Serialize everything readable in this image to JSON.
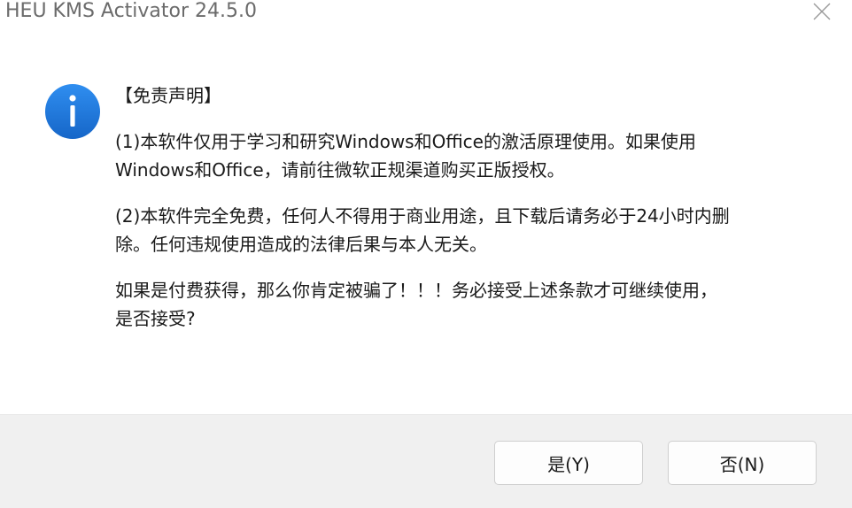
{
  "window": {
    "title": "HEU KMS Activator 24.5.0",
    "close_icon": "close-icon"
  },
  "message": {
    "heading": "【免责声明】",
    "p1_line1": "(1)本软件仅用于学习和研究Windows和Office的激活原理使用。如果使用",
    "p1_line2": "Windows和Office，请前往微软正规渠道购买正版授权。",
    "p2_line1": "(2)本软件完全免费，任何人不得用于商业用途，且下载后请务必于24小时内删",
    "p2_line2": "除。任何违规使用造成的法律后果与本人无关。",
    "p3_line1": "如果是付费获得，那么你肯定被骗了！！！务必接受上述条款才可继续使用，",
    "p3_line2": "是否接受?"
  },
  "icon": {
    "name": "info-icon",
    "color": "#1a73d9"
  },
  "buttons": {
    "yes_label": "是(Y)",
    "no_label": "否(N)"
  }
}
